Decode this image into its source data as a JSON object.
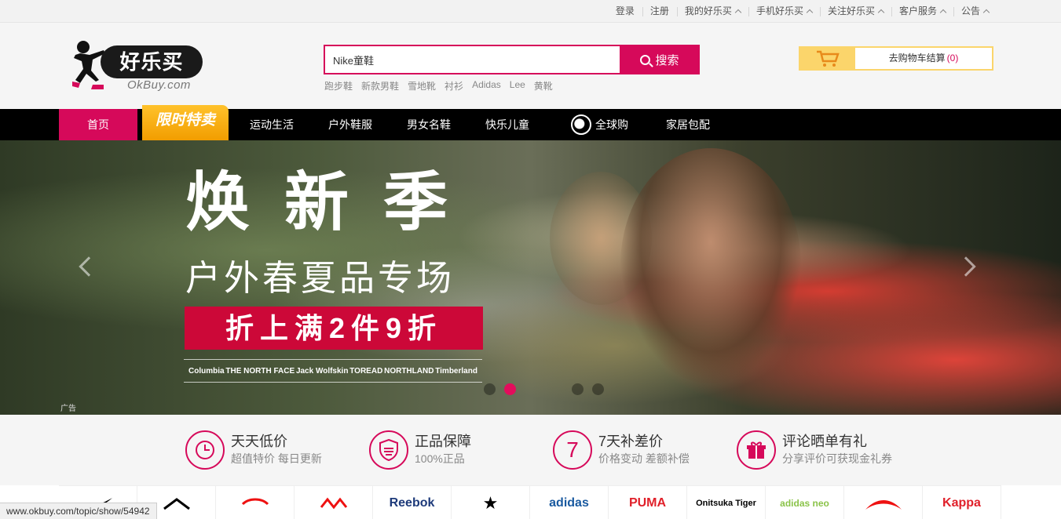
{
  "topbar": {
    "links": [
      {
        "label": "登录",
        "caret": false
      },
      {
        "label": "注册",
        "caret": false
      },
      {
        "label": "我的好乐买",
        "caret": true
      },
      {
        "label": "手机好乐买",
        "caret": true
      },
      {
        "label": "关注好乐买",
        "caret": true
      },
      {
        "label": "客户服务",
        "caret": true
      },
      {
        "label": "公告",
        "caret": true
      }
    ]
  },
  "logo": {
    "name": "好乐买",
    "sub": "OkBuy.com"
  },
  "search": {
    "value": "Nike童鞋",
    "button_label": "搜索",
    "hot_words": [
      "跑步鞋",
      "新款男鞋",
      "雪地靴",
      "衬衫",
      "Adidas",
      "Lee",
      "黄靴"
    ]
  },
  "cart": {
    "label": "去购物车结算",
    "count": "(0)"
  },
  "nav": {
    "home": "首页",
    "flash_sale": "限时特卖",
    "items": [
      "运动生活",
      "户外鞋服",
      "男女名鞋",
      "快乐儿童"
    ],
    "global": "全球购",
    "home_goods": "家居包配"
  },
  "banner": {
    "title": "焕新季",
    "subtitle": "户外春夏品专场",
    "promo": "折上满2件9折",
    "brands": [
      "Columbia",
      "THE NORTH FACE",
      "Jack Wolfskin",
      "TOREAD",
      "NORTHLAND",
      "Timberland"
    ],
    "ad_label": "广告",
    "dot_count": 6,
    "active_dot": 1
  },
  "features": [
    {
      "icon": "clock-icon",
      "title": "天天低价",
      "desc": "超值特价 每日更新"
    },
    {
      "icon": "shield-icon",
      "title": "正品保障",
      "desc": "100%正品"
    },
    {
      "icon": "seven-days-icon",
      "title": "7天补差价",
      "desc": "价格变动 差额补偿",
      "glyph": "7"
    },
    {
      "icon": "gift-icon",
      "title": "评论晒单有礼",
      "desc": "分享评价可获现金礼券"
    }
  ],
  "brand_strip": [
    {
      "label": "",
      "color": "#000"
    },
    {
      "label": "",
      "color": "#000"
    },
    {
      "label": "",
      "color": "#e11"
    },
    {
      "label": "",
      "color": "#e11"
    },
    {
      "label": "Reebok",
      "color": "#1d3a7a"
    },
    {
      "label": "★",
      "color": "#000"
    },
    {
      "label": "adidas",
      "color": "#1a5aa0"
    },
    {
      "label": "PUMA",
      "color": "#e0202a"
    },
    {
      "label": "Onitsuka Tiger",
      "color": "#000"
    },
    {
      "label": "adidas neo",
      "color": "#8bc34a"
    },
    {
      "label": "",
      "color": "#e11"
    },
    {
      "label": "Kappa",
      "color": "#e0202a"
    }
  ],
  "status_url": "www.okbuy.com/topic/show/54942",
  "colors": {
    "brand": "#d6095a",
    "flash": "#f5a800",
    "cart": "#fbd56b"
  }
}
